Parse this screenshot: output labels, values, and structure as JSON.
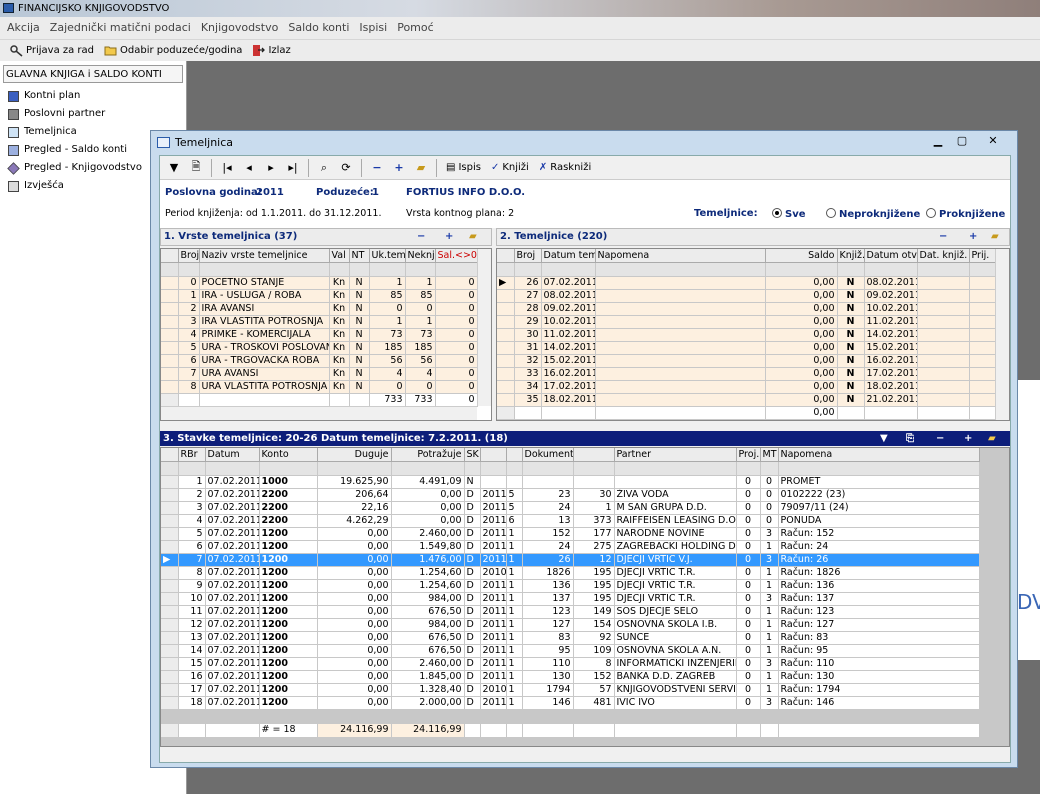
{
  "app": {
    "title": "FINANCIJSKO KNJIGOVODSTVO"
  },
  "menu": [
    "Akcija",
    "Zajednički matični podaci",
    "Knjigovodstvo",
    "Saldo konti",
    "Ispisi",
    "Pomoć"
  ],
  "toolbar": {
    "login": "Prijava za rad",
    "select_company": "Odabir poduzeće/godina",
    "exit": "Izlaz"
  },
  "sidebar": {
    "title": "GLAVNA KNJIGA i SALDO KONTI",
    "items": [
      "Kontni plan",
      "Poslovni partner",
      "Temeljnica",
      "Pregled - Saldo konti",
      "Pregled - Knjigovodstvo",
      "Izvješća"
    ]
  },
  "window": {
    "title": "Temeljnica",
    "toolbar": {
      "print": "Ispis",
      "post": "Knjiži",
      "unpost": "Raskniži"
    },
    "info": {
      "year_label": "Poslovna godina:",
      "year": "2011",
      "company_label": "Poduzeće:",
      "company_id": "1",
      "company_name": "FORTIUS INFO D.O.O.",
      "period": "Period knjiženja: od 1.1.2011. do 31.12.2011.",
      "plan": "Vrsta kontnog plana: 2",
      "filter_label": "Temeljnice:",
      "filters": [
        "Sve",
        "Neproknjižene",
        "Proknjižene"
      ],
      "filter_selected": "Sve"
    },
    "types": {
      "title": "1. Vrste temeljnica (37)",
      "columns": [
        "Broj",
        "Naziv vrste temeljnice",
        "Val",
        "NT",
        "Uk.tem.",
        "Neknj.",
        "Sal.<>0"
      ],
      "rows": [
        [
          "0",
          "POČETNO STANJE",
          "Kn",
          "N",
          "1",
          "1",
          "0"
        ],
        [
          "1",
          "IRA - USLUGA / ROBA",
          "Kn",
          "N",
          "85",
          "85",
          "0"
        ],
        [
          "2",
          "IRA AVANSI",
          "Kn",
          "N",
          "0",
          "0",
          "0"
        ],
        [
          "3",
          "IRA VLASTITA POTROŠNJA",
          "Kn",
          "N",
          "1",
          "1",
          "0"
        ],
        [
          "4",
          "PRIMKE - KOMERCIJALA",
          "Kn",
          "N",
          "73",
          "73",
          "0"
        ],
        [
          "5",
          "URA - TROŠKOVI POSLOVANJA",
          "Kn",
          "N",
          "185",
          "185",
          "0"
        ],
        [
          "6",
          "URA - TRGOVAČKA ROBA",
          "Kn",
          "N",
          "56",
          "56",
          "0"
        ],
        [
          "7",
          "URA AVANSI",
          "Kn",
          "N",
          "4",
          "4",
          "0"
        ],
        [
          "8",
          "URA VLASTITA POTROŠNJA",
          "Kn",
          "N",
          "0",
          "0",
          "0"
        ]
      ],
      "totals": [
        "733",
        "733",
        "0"
      ]
    },
    "journals": {
      "title": "2. Temeljnice (220)",
      "columns": [
        "Broj",
        "Datum tem.",
        "Napomena",
        "Saldo",
        "Knjiž.",
        "Datum otv.",
        "Dat. knjiž.",
        "Prij."
      ],
      "rows": [
        [
          "26",
          "07.02.2011.",
          "",
          "0,00",
          "N",
          "08.02.2011."
        ],
        [
          "27",
          "08.02.2011.",
          "",
          "0,00",
          "N",
          "09.02.2011."
        ],
        [
          "28",
          "09.02.2011.",
          "",
          "0,00",
          "N",
          "10.02.2011."
        ],
        [
          "29",
          "10.02.2011.",
          "",
          "0,00",
          "N",
          "11.02.2011."
        ],
        [
          "30",
          "11.02.2011.",
          "",
          "0,00",
          "N",
          "14.02.2011."
        ],
        [
          "31",
          "14.02.2011.",
          "",
          "0,00",
          "N",
          "15.02.2011."
        ],
        [
          "32",
          "15.02.2011.",
          "",
          "0,00",
          "N",
          "16.02.2011."
        ],
        [
          "33",
          "16.02.2011.",
          "",
          "0,00",
          "N",
          "17.02.2011."
        ],
        [
          "34",
          "17.02.2011.",
          "",
          "0,00",
          "N",
          "18.02.2011."
        ],
        [
          "35",
          "18.02.2011.",
          "",
          "0,00",
          "N",
          "21.02.2011."
        ]
      ],
      "total": "0,00"
    },
    "items": {
      "title": "3. Stavke temeljnice: 20-26   Datum temeljnice: 7.2.2011.   (18)",
      "columns": [
        "RBr",
        "Datum",
        "Konto",
        "Duguje",
        "Potražuje",
        "SK",
        "",
        "",
        "Dokument",
        "",
        "Partner",
        "Proj.",
        "MT",
        "Napomena"
      ],
      "rows": [
        [
          "1",
          "07.02.2011.",
          "1000",
          "19.625,90",
          "4.491,09",
          "N",
          "",
          "",
          "",
          "",
          "",
          "0",
          "0",
          "PROMET"
        ],
        [
          "2",
          "07.02.2011.",
          "2200",
          "206,64",
          "0,00",
          "D",
          "2011",
          "5",
          "23",
          "30",
          "ŽIVA VODA",
          "0",
          "0",
          "0102222 (23)"
        ],
        [
          "3",
          "07.02.2011.",
          "2200",
          "22,16",
          "0,00",
          "D",
          "2011",
          "5",
          "24",
          "1",
          "M SAN GRUPA D.D.",
          "0",
          "0",
          "79097/11 (24)"
        ],
        [
          "4",
          "07.02.2011.",
          "2200",
          "4.262,29",
          "0,00",
          "D",
          "2011",
          "6",
          "13",
          "373",
          "RAIFFEISEN LEASING D.O.",
          "0",
          "0",
          "PONUDA"
        ],
        [
          "5",
          "07.02.2011.",
          "1200",
          "0,00",
          "2.460,00",
          "D",
          "2011",
          "1",
          "152",
          "177",
          "NARODNE NOVINE",
          "0",
          "3",
          "Račun: 152"
        ],
        [
          "6",
          "07.02.2011.",
          "1200",
          "0,00",
          "1.549,80",
          "D",
          "2011",
          "1",
          "24",
          "275",
          "ZAGREBAČKI HOLDING D.O.",
          "0",
          "1",
          "Račun: 24"
        ],
        [
          "7",
          "07.02.2011.",
          "1200",
          "0,00",
          "1.476,00",
          "D",
          "2011",
          "1",
          "26",
          "12",
          "DJEČJI VRTIĆ V.J.",
          "0",
          "3",
          "Račun: 26"
        ],
        [
          "8",
          "07.02.2011.",
          "1200",
          "0,00",
          "1.254,60",
          "D",
          "2010",
          "1",
          "1826",
          "195",
          "DJEČJI VRTIĆ T.R.",
          "0",
          "1",
          "Račun: 1826"
        ],
        [
          "9",
          "07.02.2011.",
          "1200",
          "0,00",
          "1.254,60",
          "D",
          "2011",
          "1",
          "136",
          "195",
          "DJEČJI VRTIĆ T.R.",
          "0",
          "1",
          "Račun: 136"
        ],
        [
          "10",
          "07.02.2011.",
          "1200",
          "0,00",
          "984,00",
          "D",
          "2011",
          "1",
          "137",
          "195",
          "DJEČJI VRTIĆ T.R.",
          "0",
          "3",
          "Račun: 137"
        ],
        [
          "11",
          "07.02.2011.",
          "1200",
          "0,00",
          "676,50",
          "D",
          "2011",
          "1",
          "123",
          "149",
          "SOS DJEČJE SELO",
          "0",
          "1",
          "Račun: 123"
        ],
        [
          "12",
          "07.02.2011.",
          "1200",
          "0,00",
          "984,00",
          "D",
          "2011",
          "1",
          "127",
          "154",
          "OSNOVNA ŠKOLA I.B.",
          "0",
          "1",
          "Račun: 127"
        ],
        [
          "13",
          "07.02.2011.",
          "1200",
          "0,00",
          "676,50",
          "D",
          "2011",
          "1",
          "83",
          "92",
          "SUNCE",
          "0",
          "1",
          "Račun: 83"
        ],
        [
          "14",
          "07.02.2011.",
          "1200",
          "0,00",
          "676,50",
          "D",
          "2011",
          "1",
          "95",
          "109",
          "OSNOVNA ŠKOLA A.N.",
          "0",
          "1",
          "Račun: 95"
        ],
        [
          "15",
          "07.02.2011.",
          "1200",
          "0,00",
          "2.460,00",
          "D",
          "2011",
          "1",
          "110",
          "8",
          "INFORMATIČKI INŽENJERING",
          "0",
          "3",
          "Račun: 110"
        ],
        [
          "16",
          "07.02.2011.",
          "1200",
          "0,00",
          "1.845,00",
          "D",
          "2011",
          "1",
          "130",
          "152",
          "BANKA D.D. ZAGREB",
          "0",
          "1",
          "Račun: 130"
        ],
        [
          "17",
          "07.02.2011.",
          "1200",
          "0,00",
          "1.328,40",
          "D",
          "2010",
          "1",
          "1794",
          "57",
          "KNJIGOVODSTVENI SERVIS",
          "0",
          "1",
          "Račun: 1794"
        ],
        [
          "18",
          "07.02.2011.",
          "1200",
          "0,00",
          "2.000,00",
          "D",
          "2011",
          "1",
          "146",
          "481",
          "IVIĆ IVO",
          "0",
          "3",
          "Račun: 146"
        ]
      ],
      "selected_row": 7,
      "footer_count": "# = 18",
      "footer_debit": "24.116,99",
      "footer_credit": "24.116,99"
    }
  },
  "desktop": {
    "partial_text": "DV"
  },
  "colors": {
    "selection": "#3399ff",
    "header_navy": "#0d1e7a",
    "row_tint": "#fdf0e0"
  }
}
